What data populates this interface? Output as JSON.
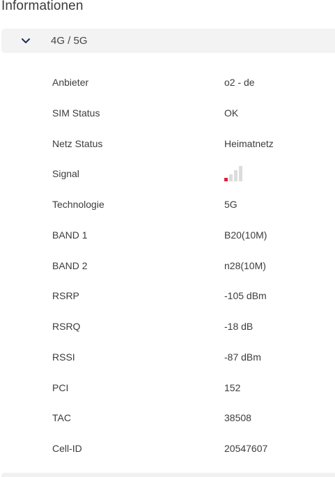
{
  "page": {
    "title": "Informationen"
  },
  "section": {
    "title": "4G / 5G",
    "expanded": true,
    "chevron_icon": "chevron-down-icon"
  },
  "rows": [
    {
      "label": "Anbieter",
      "value": "o2 - de"
    },
    {
      "label": "SIM Status",
      "value": "OK"
    },
    {
      "label": "Netz Status",
      "value": "Heimatnetz"
    },
    {
      "label": "Signal",
      "value": ""
    },
    {
      "label": "Technologie",
      "value": "5G"
    },
    {
      "label": "BAND 1",
      "value": "B20(10M)"
    },
    {
      "label": "BAND 2",
      "value": "n28(10M)"
    },
    {
      "label": "RSRP",
      "value": "-105 dBm"
    },
    {
      "label": "RSRQ",
      "value": "-18 dB"
    },
    {
      "label": "RSSI",
      "value": "-87 dBm"
    },
    {
      "label": "PCI",
      "value": "152"
    },
    {
      "label": "TAC",
      "value": "38508"
    },
    {
      "label": "Cell-ID",
      "value": "20547607"
    }
  ],
  "signal": {
    "icon": "signal-bars-icon",
    "level": 1,
    "max": 4,
    "active_color": "#e0203a",
    "inactive_color": "#dcdcdc"
  },
  "colors": {
    "header_bg": "#f3f3f4",
    "chevron": "#1f2d5a"
  }
}
